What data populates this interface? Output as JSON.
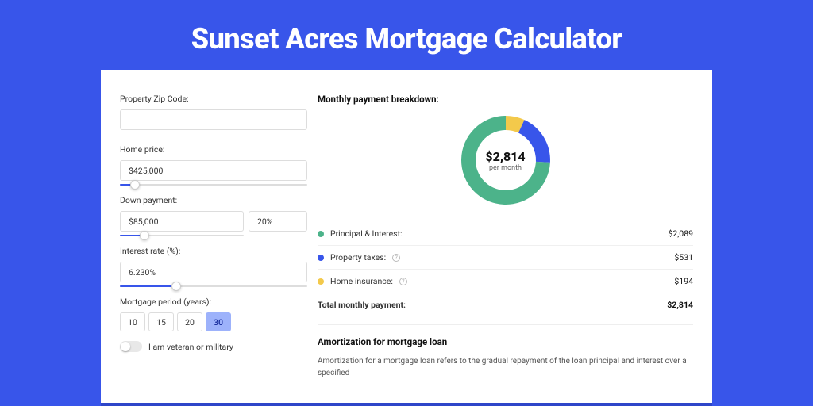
{
  "title": "Sunset Acres Mortgage Calculator",
  "form": {
    "zip_label": "Property Zip Code:",
    "zip_value": "",
    "home_price_label": "Home price:",
    "home_price_value": "$425,000",
    "home_price_slider_pct": 8,
    "down_payment_label": "Down payment:",
    "down_payment_value": "$85,000",
    "down_payment_pct_value": "20%",
    "down_payment_slider_pct": 20,
    "interest_label": "Interest rate (%):",
    "interest_value": "6.230%",
    "interest_slider_pct": 30,
    "period_label": "Mortgage period (years):",
    "periods": [
      {
        "label": "10",
        "active": false
      },
      {
        "label": "15",
        "active": false
      },
      {
        "label": "20",
        "active": false
      },
      {
        "label": "30",
        "active": true
      }
    ],
    "veteran_label": "I am veteran or military",
    "veteran_on": false
  },
  "breakdown": {
    "header": "Monthly payment breakdown:",
    "center_amount": "$2,814",
    "center_sub": "per month",
    "items": [
      {
        "label": "Principal & Interest:",
        "value": "$2,089",
        "color": "#4cb38a",
        "info": false,
        "pct": 74.2
      },
      {
        "label": "Property taxes:",
        "value": "$531",
        "color": "#3855ea",
        "info": true,
        "pct": 18.9
      },
      {
        "label": "Home insurance:",
        "value": "$194",
        "color": "#f3c94b",
        "info": true,
        "pct": 6.9
      }
    ],
    "total_label": "Total monthly payment:",
    "total_value": "$2,814"
  },
  "amort": {
    "header": "Amortization for mortgage loan",
    "desc": "Amortization for a mortgage loan refers to the gradual repayment of the loan principal and interest over a specified"
  },
  "chart_data": {
    "type": "pie",
    "title": "Monthly payment breakdown",
    "series": [
      {
        "name": "Principal & Interest",
        "value": 2089,
        "color": "#4cb38a"
      },
      {
        "name": "Property taxes",
        "value": 531,
        "color": "#3855ea"
      },
      {
        "name": "Home insurance",
        "value": 194,
        "color": "#f3c94b"
      }
    ],
    "total": 2814,
    "units": "USD per month"
  }
}
